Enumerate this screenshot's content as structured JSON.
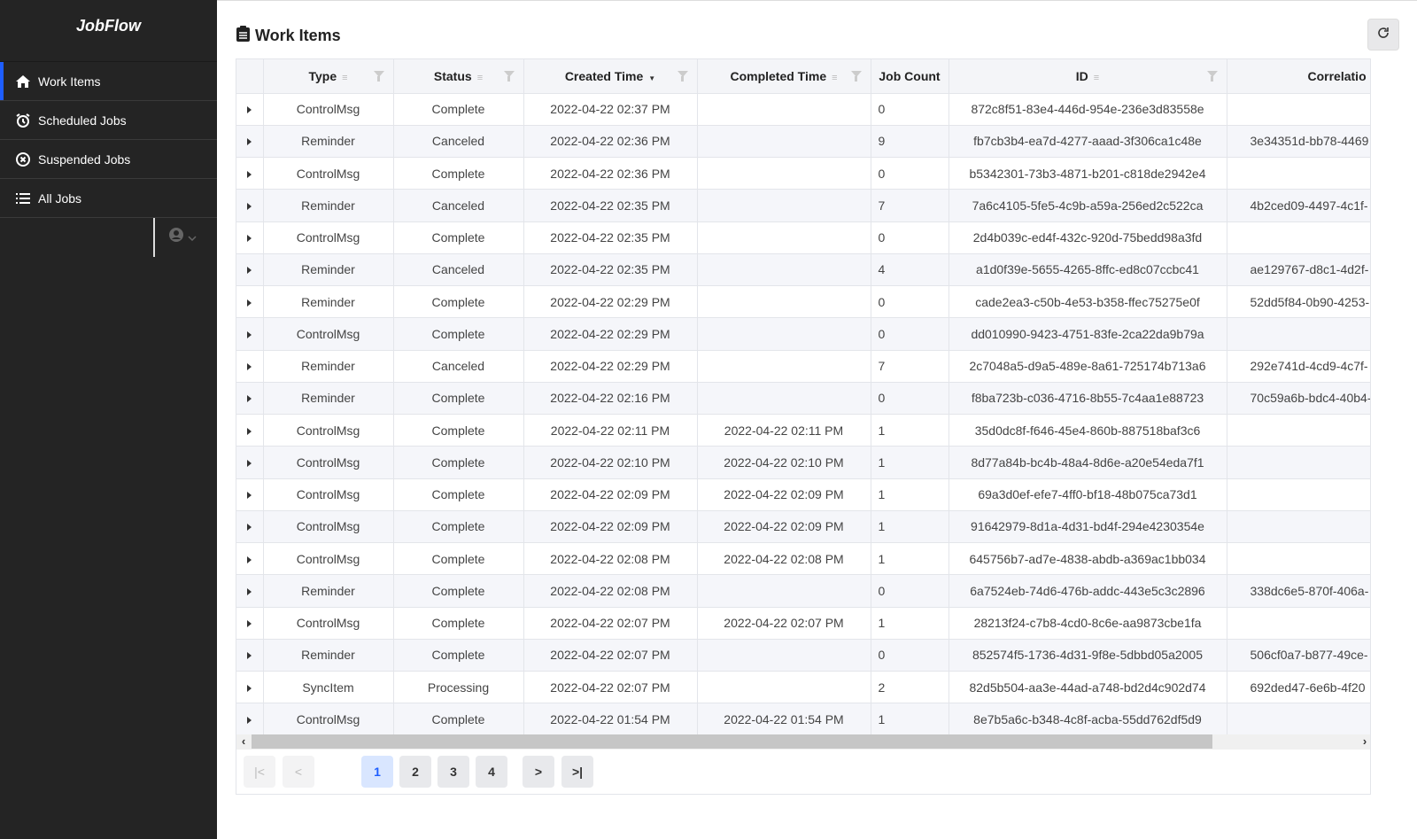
{
  "app": {
    "brand": "JobFlow"
  },
  "sidebar": {
    "items": [
      {
        "label": "Work Items",
        "icon": "home-icon",
        "active": true
      },
      {
        "label": "Scheduled Jobs",
        "icon": "alarm-clock-icon"
      },
      {
        "label": "Suspended Jobs",
        "icon": "x-circle-icon"
      },
      {
        "label": "All Jobs",
        "icon": "list-icon"
      }
    ]
  },
  "header": {
    "title": "Work Items"
  },
  "table": {
    "columns": [
      "Type",
      "Status",
      "Created Time",
      "Completed Time",
      "Job Count",
      "ID",
      "Correlatio"
    ],
    "sorted_column": "Created Time",
    "sort_direction": "desc",
    "rows": [
      [
        "ControlMsg",
        "Complete",
        "2022-04-22 02:37 PM",
        "",
        "0",
        "872c8f51-83e4-446d-954e-236e3d83558e",
        ""
      ],
      [
        "Reminder",
        "Canceled",
        "2022-04-22 02:36 PM",
        "",
        "9",
        "fb7cb3b4-ea7d-4277-aaad-3f306ca1c48e",
        "3e34351d-bb78-4469"
      ],
      [
        "ControlMsg",
        "Complete",
        "2022-04-22 02:36 PM",
        "",
        "0",
        "b5342301-73b3-4871-b201-c818de2942e4",
        ""
      ],
      [
        "Reminder",
        "Canceled",
        "2022-04-22 02:35 PM",
        "",
        "7",
        "7a6c4105-5fe5-4c9b-a59a-256ed2c522ca",
        "4b2ced09-4497-4c1f-"
      ],
      [
        "ControlMsg",
        "Complete",
        "2022-04-22 02:35 PM",
        "",
        "0",
        "2d4b039c-ed4f-432c-920d-75bedd98a3fd",
        ""
      ],
      [
        "Reminder",
        "Canceled",
        "2022-04-22 02:35 PM",
        "",
        "4",
        "a1d0f39e-5655-4265-8ffc-ed8c07ccbc41",
        "ae129767-d8c1-4d2f-"
      ],
      [
        "Reminder",
        "Complete",
        "2022-04-22 02:29 PM",
        "",
        "0",
        "cade2ea3-c50b-4e53-b358-ffec75275e0f",
        "52dd5f84-0b90-4253-"
      ],
      [
        "ControlMsg",
        "Complete",
        "2022-04-22 02:29 PM",
        "",
        "0",
        "dd010990-9423-4751-83fe-2ca22da9b79a",
        ""
      ],
      [
        "Reminder",
        "Canceled",
        "2022-04-22 02:29 PM",
        "",
        "7",
        "2c7048a5-d9a5-489e-8a61-725174b713a6",
        "292e741d-4cd9-4c7f-"
      ],
      [
        "Reminder",
        "Complete",
        "2022-04-22 02:16 PM",
        "",
        "0",
        "f8ba723b-c036-4716-8b55-7c4aa1e88723",
        "70c59a6b-bdc4-40b4-"
      ],
      [
        "ControlMsg",
        "Complete",
        "2022-04-22 02:11 PM",
        "2022-04-22 02:11 PM",
        "1",
        "35d0dc8f-f646-45e4-860b-887518baf3c6",
        ""
      ],
      [
        "ControlMsg",
        "Complete",
        "2022-04-22 02:10 PM",
        "2022-04-22 02:10 PM",
        "1",
        "8d77a84b-bc4b-48a4-8d6e-a20e54eda7f1",
        ""
      ],
      [
        "ControlMsg",
        "Complete",
        "2022-04-22 02:09 PM",
        "2022-04-22 02:09 PM",
        "1",
        "69a3d0ef-efe7-4ff0-bf18-48b075ca73d1",
        ""
      ],
      [
        "ControlMsg",
        "Complete",
        "2022-04-22 02:09 PM",
        "2022-04-22 02:09 PM",
        "1",
        "91642979-8d1a-4d31-bd4f-294e4230354e",
        ""
      ],
      [
        "ControlMsg",
        "Complete",
        "2022-04-22 02:08 PM",
        "2022-04-22 02:08 PM",
        "1",
        "645756b7-ad7e-4838-abdb-a369ac1bb034",
        ""
      ],
      [
        "Reminder",
        "Complete",
        "2022-04-22 02:08 PM",
        "",
        "0",
        "6a7524eb-74d6-476b-addc-443e5c3c2896",
        "338dc6e5-870f-406a-"
      ],
      [
        "ControlMsg",
        "Complete",
        "2022-04-22 02:07 PM",
        "2022-04-22 02:07 PM",
        "1",
        "28213f24-c7b8-4cd0-8c6e-aa9873cbe1fa",
        ""
      ],
      [
        "Reminder",
        "Complete",
        "2022-04-22 02:07 PM",
        "",
        "0",
        "852574f5-1736-4d31-9f8e-5dbbd05a2005",
        "506cf0a7-b877-49ce-"
      ],
      [
        "SyncItem",
        "Processing",
        "2022-04-22 02:07 PM",
        "",
        "2",
        "82d5b504-aa3e-44ad-a748-bd2d4c902d74",
        "692ded47-6e6b-4f20"
      ],
      [
        "ControlMsg",
        "Complete",
        "2022-04-22 01:54 PM",
        "2022-04-22 01:54 PM",
        "1",
        "8e7b5a6c-b348-4c8f-acba-55dd762df5d9",
        ""
      ]
    ]
  },
  "pagination": {
    "pages": [
      "1",
      "2",
      "3",
      "4"
    ],
    "current": "1"
  },
  "colors": {
    "accent": "#1e5eff",
    "sidebar_bg": "#242424"
  }
}
